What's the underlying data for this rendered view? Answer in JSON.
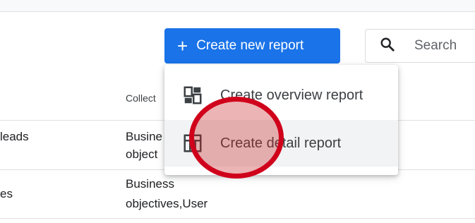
{
  "toolbar": {
    "create_label": "Create new report",
    "search_placeholder": "Search"
  },
  "table": {
    "collection_header": "Collect",
    "rows": [
      {
        "name": "leads",
        "collection_line1": "Busine",
        "collection_line2": "object"
      },
      {
        "name": "es",
        "collection_line1": "Business",
        "collection_line2": "objectives,User"
      }
    ]
  },
  "menu": {
    "items": [
      {
        "label": "Create overview report",
        "icon": "dashboard-icon"
      },
      {
        "label": "Create detail report",
        "icon": "table-layout-icon"
      }
    ]
  },
  "colors": {
    "primary": "#1a73e8",
    "click_indicator": "#d0021b"
  }
}
